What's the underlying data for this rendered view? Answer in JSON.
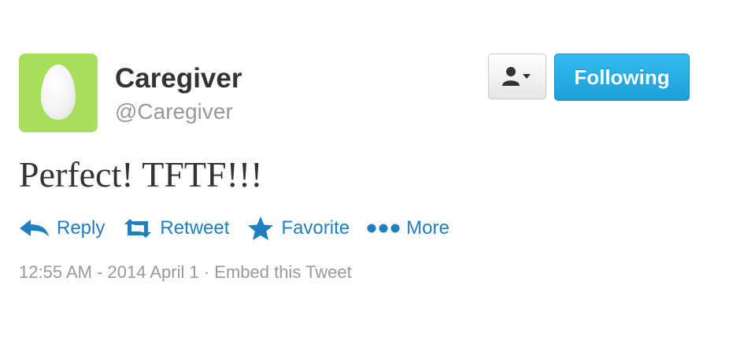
{
  "profile": {
    "name": "Caregiver",
    "handle": "@Caregiver",
    "avatar_color": "#a6e05c"
  },
  "follow_button": {
    "label": "Following",
    "color": "#1d9fd8"
  },
  "user_dropdown": {
    "icon": "user-dropdown-icon"
  },
  "tweet": {
    "text": "Perfect! TFTF!!!"
  },
  "actions": [
    {
      "label": "Reply",
      "icon": "reply-icon"
    },
    {
      "label": "Retweet",
      "icon": "retweet-icon"
    },
    {
      "label": "Favorite",
      "icon": "star-icon"
    },
    {
      "label": "More",
      "icon": "more-dots-icon"
    }
  ],
  "meta": {
    "timestamp": "12:55 AM - 2014 April 1",
    "separator": " · ",
    "embed_label": "Embed this Tweet"
  },
  "colors": {
    "link": "#1f7fc0",
    "muted": "#999999",
    "text": "#333333"
  }
}
